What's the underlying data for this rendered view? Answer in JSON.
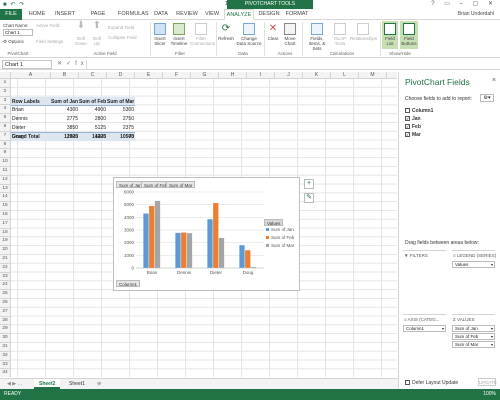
{
  "window": {
    "title": "1st Qtr Sales - Excel",
    "context_tab_group": "PIVOTCHART TOOLS",
    "user": "Brian Underdahl"
  },
  "tabs": [
    "FILE",
    "HOME",
    "INSERT",
    "PAGE LAYOUT",
    "FORMULAS",
    "DATA",
    "REVIEW",
    "VIEW",
    "ANALYZE",
    "DESIGN",
    "FORMAT"
  ],
  "active_tab": "ANALYZE",
  "ribbon": {
    "chart_name_label": "Chart Name:",
    "chart_name_value": "Chart 1",
    "options_label": "Options",
    "active_field_label": "Active Field:",
    "field_settings_label": "Field Settings",
    "drill_down_label": "Drill Down",
    "drill_up_label": "Drill Up",
    "expand_field_label": "Expand Field",
    "collapse_field_label": "Collapse Field",
    "insert_slicer_label": "Insert Slicer",
    "insert_timeline_label": "Insert Timeline",
    "filter_connections_label": "Filter Connections",
    "refresh_label": "Refresh",
    "change_source_label": "Change Data Source",
    "clear_label": "Clear",
    "move_chart_label": "Move Chart",
    "fields_items_label": "Fields, Items, & Sets",
    "olap_tools_label": "OLAP Tools",
    "relationships_label": "Relationships",
    "field_list_label": "Field List",
    "field_buttons_label": "Field Buttons",
    "groups": [
      "PivotChart",
      "Active Field",
      "Filter",
      "Data",
      "Actions",
      "Calculations",
      "Show/Hide"
    ]
  },
  "formula_bar": {
    "name_box": "Chart 1",
    "fx": "fx"
  },
  "columns": [
    "A",
    "B",
    "C",
    "D",
    "E",
    "F",
    "G",
    "H",
    "I",
    "J",
    "K",
    "L",
    "M",
    "N"
  ],
  "rows": [
    "1",
    "2",
    "3",
    "4",
    "5",
    "6",
    "7",
    "8",
    "9",
    "10",
    "11",
    "12",
    "13",
    "14",
    "15",
    "16",
    "17",
    "18",
    "19",
    "20",
    "21",
    "22",
    "23",
    "24",
    "25",
    "26",
    "27",
    "28",
    "29",
    "30",
    "31",
    "32",
    "33",
    "34"
  ],
  "pivot": {
    "headers": [
      "Row Labels",
      "Sum of Jan",
      "Sum of Feb",
      "Sum of Mar"
    ],
    "rows": [
      [
        "Brian",
        "4300",
        "4900",
        "5300"
      ],
      [
        "Dennis",
        "2775",
        "2800",
        "2750"
      ],
      [
        "Dieter",
        "3850",
        "5125",
        "2375"
      ],
      [
        "Doug",
        "1800",
        "1400",
        "75"
      ]
    ],
    "total": [
      "Grand Total",
      "12925",
      "14225",
      "10500"
    ]
  },
  "chart_data": {
    "type": "bar",
    "categories": [
      "Brian",
      "Dennis",
      "Dieter",
      "Doug"
    ],
    "series": [
      {
        "name": "Sum of Jan",
        "values": [
          4300,
          2775,
          3850,
          1800
        ],
        "color": "#5b9bd5"
      },
      {
        "name": "Sum of Feb",
        "values": [
          4900,
          2800,
          5125,
          1400
        ],
        "color": "#ed7d31"
      },
      {
        "name": "Sum of Mar",
        "values": [
          5300,
          2750,
          2375,
          75
        ],
        "color": "#a5a5a5"
      }
    ],
    "y_ticks": [
      "0",
      "1000",
      "2000",
      "3000",
      "4000",
      "5000",
      "6000"
    ],
    "ylim": [
      0,
      6000
    ],
    "legend_title": "Values",
    "legend_position": "right",
    "axis_field_button": "Column1",
    "grid": true
  },
  "sheets": [
    "Sheet2",
    "Sheet1"
  ],
  "active_sheet": "Sheet2",
  "status": {
    "ready": "READY",
    "zoom": "100%"
  },
  "panel": {
    "title": "PivotChart Fields",
    "close": "×",
    "choose_label": "Choose fields to add to report:",
    "fields": [
      {
        "label": "Column1",
        "checked": false
      },
      {
        "label": "Jan",
        "checked": true
      },
      {
        "label": "Feb",
        "checked": true
      },
      {
        "label": "Mar",
        "checked": true
      }
    ],
    "drag_label": "Drag fields between areas below:",
    "filters_label": "FILTERS",
    "legend_label": "LEGEND (SERIES)",
    "legend_items": [
      "Values"
    ],
    "axis_label": "AXIS (CATEG...",
    "axis_items": [
      "Column1"
    ],
    "values_label": "VALUES",
    "values_items": [
      "Sum of Jan",
      "Sum of Feb",
      "Sum of Mar"
    ],
    "defer_label": "Defer Layout Update",
    "update_label": "UPDATE"
  }
}
